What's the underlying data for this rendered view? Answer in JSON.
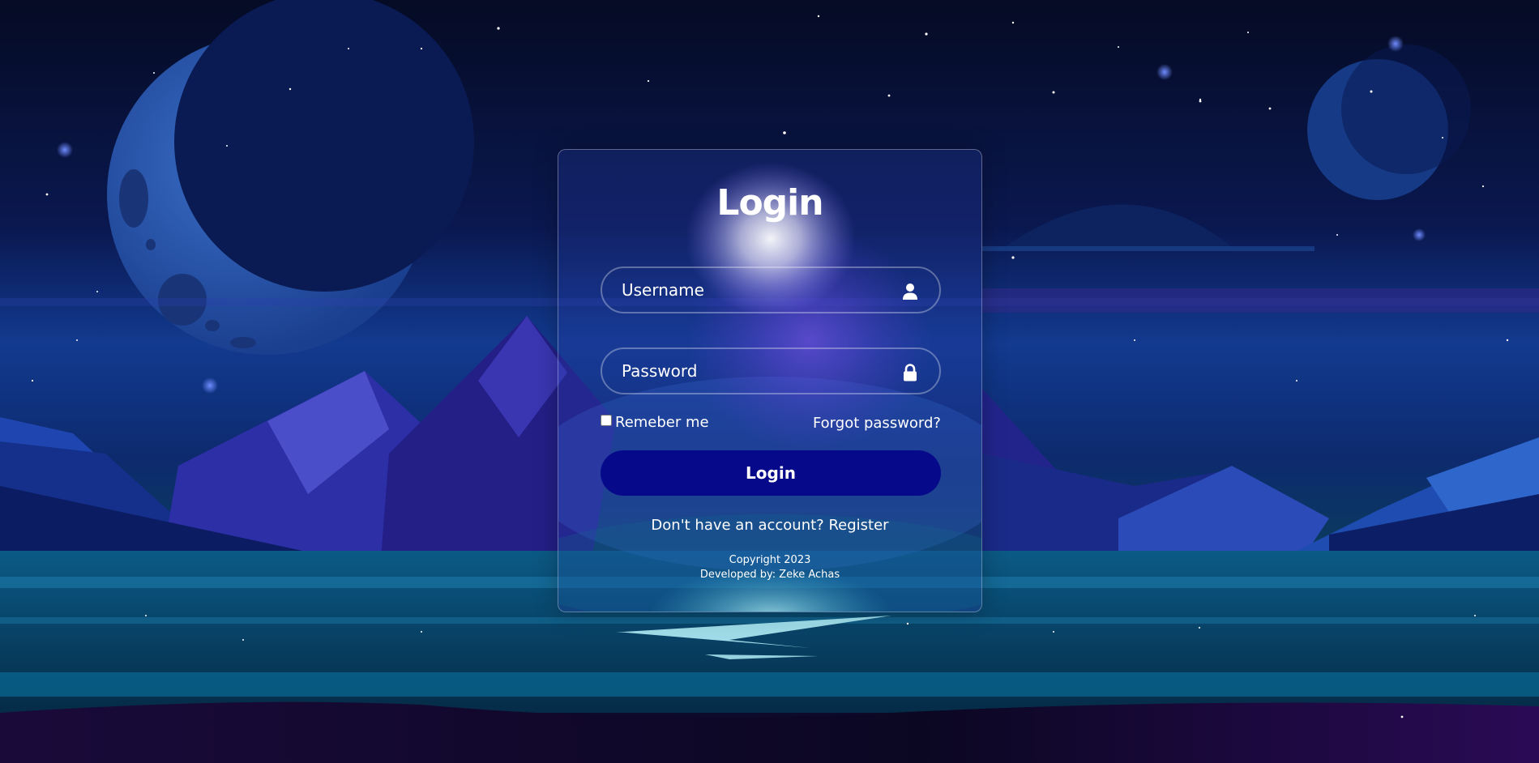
{
  "login_form": {
    "title": "Login",
    "username": {
      "placeholder": "Username",
      "value": "",
      "icon": "user-icon"
    },
    "password": {
      "placeholder": "Password",
      "value": "",
      "icon": "lock-icon"
    },
    "remember_me": {
      "label": "Remeber me",
      "checked": false
    },
    "forgot_password_label": "Forgot password?",
    "submit_label": "Login",
    "register_prompt": "Don't have an account?",
    "register_link_label": "Register"
  },
  "footer": {
    "copyright": "Copyright 2023",
    "developer": "Developed by: Zeke Achas"
  },
  "colors": {
    "button_bg": "#060a8a",
    "text": "#ffffff",
    "sky_top": "#050b24",
    "sky_mid": "#123a8f",
    "lake": "#06324f"
  }
}
